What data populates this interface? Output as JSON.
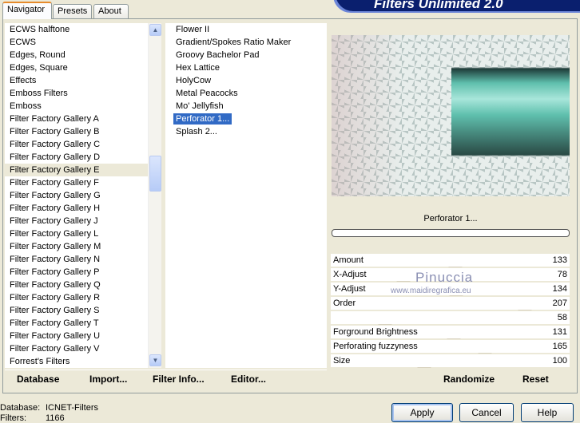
{
  "app_title": "Filters Unlimited 2.0",
  "tabs": [
    {
      "label": "Navigator"
    },
    {
      "label": "Presets"
    },
    {
      "label": "About"
    }
  ],
  "categories": [
    "ECWS halftone",
    "ECWS",
    "Edges, Round",
    "Edges, Square",
    "Effects",
    "Emboss Filters",
    "Emboss",
    "Filter Factory Gallery A",
    "Filter Factory Gallery B",
    "Filter Factory Gallery C",
    "Filter Factory Gallery D",
    "Filter Factory Gallery E",
    "Filter Factory Gallery F",
    "Filter Factory Gallery G",
    "Filter Factory Gallery H",
    "Filter Factory Gallery J",
    "Filter Factory Gallery L",
    "Filter Factory Gallery M",
    "Filter Factory Gallery N",
    "Filter Factory Gallery P",
    "Filter Factory Gallery Q",
    "Filter Factory Gallery R",
    "Filter Factory Gallery S",
    "Filter Factory Gallery T",
    "Filter Factory Gallery U",
    "Filter Factory Gallery V",
    "Forrest's Filters"
  ],
  "selected_category": "Filter Factory Gallery E",
  "filters": [
    "Flower II",
    "Gradient/Spokes Ratio Maker",
    "Groovy Bachelor Pad",
    "Hex Lattice",
    "HolyCow",
    "Metal Peacocks",
    "Mo' Jellyfish",
    "Perforator 1...",
    "Splash 2..."
  ],
  "selected_filter": "Perforator 1...",
  "filter_name": "Perforator 1...",
  "progress": 0,
  "watermark": {
    "name": "Pinuccia",
    "url": "www.maidiregrafica.eu"
  },
  "params": [
    {
      "label": "Amount",
      "value": "133"
    },
    {
      "label": "X-Adjust",
      "value": "78"
    },
    {
      "label": "Y-Adjust",
      "value": "134"
    },
    {
      "label": "Order",
      "value": "207"
    },
    {
      "label": "",
      "value": "58"
    },
    {
      "label": "Forground Brightness",
      "value": "131"
    },
    {
      "label": "Perforating fuzzyness",
      "value": "165"
    },
    {
      "label": "Size",
      "value": "100"
    }
  ],
  "param_max": 255,
  "toolbar": {
    "database": "Database",
    "import": "Import...",
    "filter_info": "Filter Info...",
    "editor": "Editor...",
    "randomize": "Randomize",
    "reset": "Reset"
  },
  "status": {
    "database_label": "Database:",
    "database_value": "ICNET-Filters",
    "filters_label": "Filters:",
    "filters_value": "1166"
  },
  "buttons": {
    "apply": "Apply",
    "cancel": "Cancel",
    "help": "Help"
  }
}
